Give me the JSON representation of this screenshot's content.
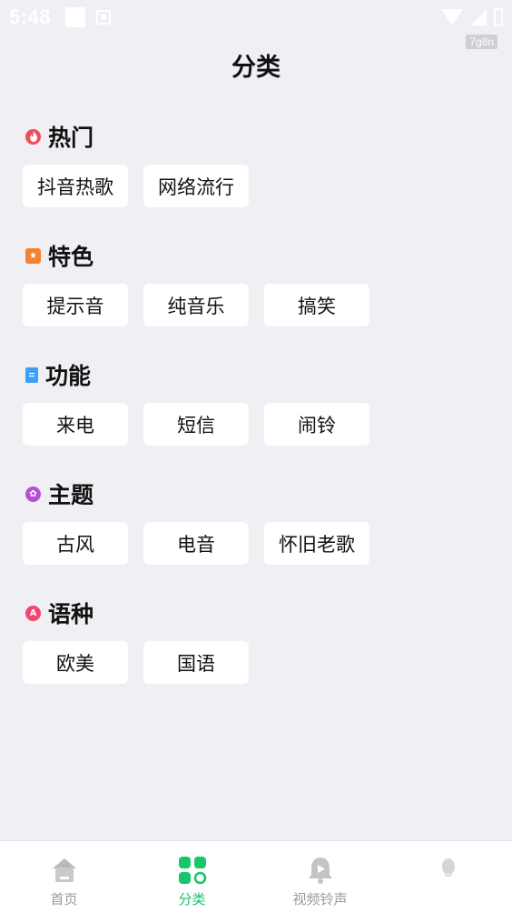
{
  "status": {
    "time": "5:48"
  },
  "watermark": "7g8n",
  "page": {
    "title": "分类"
  },
  "sections": [
    {
      "title": "热门",
      "icon": "flame-icon",
      "color": "#f04c58",
      "tags": [
        "抖音热歌",
        "网络流行"
      ]
    },
    {
      "title": "特色",
      "icon": "star-icon",
      "color": "#f5822e",
      "tags": [
        "提示音",
        "纯音乐",
        "搞笑"
      ]
    },
    {
      "title": "功能",
      "icon": "bookmark-icon",
      "color": "#3f9ef5",
      "tags": [
        "来电",
        "短信",
        "闹铃"
      ]
    },
    {
      "title": "主题",
      "icon": "flower-icon",
      "color": "#b64fd6",
      "tags": [
        "古风",
        "电音",
        "怀旧老歌"
      ]
    },
    {
      "title": "语种",
      "icon": "letter-a-icon",
      "color": "#f2466c",
      "tags": [
        "欧美",
        "国语"
      ]
    }
  ],
  "tabs": [
    {
      "label": "首页",
      "icon": "home-icon",
      "active": false
    },
    {
      "label": "分类",
      "icon": "category-grid-icon",
      "active": true
    },
    {
      "label": "视频铃声",
      "icon": "video-bell-icon",
      "active": false
    },
    {
      "label": "",
      "icon": "faint-profile-icon",
      "active": false
    }
  ],
  "colors": {
    "accent": "#18c56c",
    "background": "#efeff4",
    "inactive": "#9a9a9a"
  }
}
